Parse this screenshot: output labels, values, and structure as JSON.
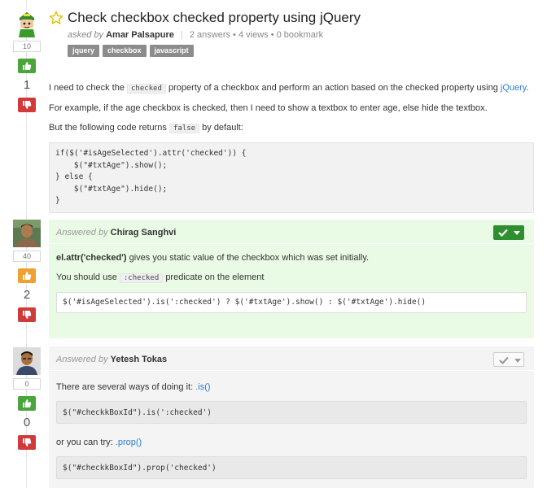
{
  "colors": {
    "accent_link": "#2a7fd4",
    "upvote_green": "#4aa53a",
    "upvote_orange": "#f0a030",
    "downvote_red": "#d03a3a",
    "accepted_bg": "#e9fbe4",
    "accepted_button": "#2f8f2f",
    "answer_bg": "#f4f4f4",
    "tag_bg": "#8c8c8c"
  },
  "question": {
    "title": "Check checkbox checked property using jQuery",
    "asked_by_prefix": "asked by",
    "author": "Amar Palsapure",
    "answers": "2 answers",
    "views": "• 4 views",
    "bookmarks": "• 0 bookmark",
    "reputation": "10",
    "score": "1",
    "tags": [
      "jquery",
      "checkbox",
      "javascript"
    ],
    "p1_before": "I need to check the",
    "p1_code": "checked",
    "p1_after": "property of a checkbox and perform an action based on the checked property using",
    "p1_link": "jQuery",
    "p1_end": ".",
    "p2": "For example, if the age checkbox is checked, then I need to show a textbox to enter age, else hide the textbox.",
    "p3_before": "But the following code returns",
    "p3_code": "false",
    "p3_after": "by default:",
    "code_lines": [
      "if($('#isAgeSelected').attr('checked')) {",
      "    $(\"#txtAge\").show();",
      "} else {",
      "    $(\"#txtAge\").hide();",
      "}"
    ]
  },
  "answers": [
    {
      "answered_by_prefix": "Answered by",
      "author": "Chirag Sanghvi",
      "reputation": "40",
      "score": "2",
      "accepted": true,
      "p1_bold": "el.attr('checked')",
      "p1_rest": "gives you static value of the checkbox which was set initially.",
      "p2_before": "You should use",
      "p2_code": ":checked",
      "p2_after": "predicate on the element",
      "code": "$('#isAgeSelected').is(':checked') ? $('#txtAge').show() : $('#txtAge').hide()"
    },
    {
      "answered_by_prefix": "Answered by",
      "author": "Yetesh Tokas",
      "reputation": "0",
      "score": "0",
      "accepted": false,
      "p1_before": "There are several ways of doing it:",
      "p1_link": ".is()",
      "code1": "$(\"#checkkBoxId\").is(':checked')",
      "p2_before": "or you can try:",
      "p2_link": ".prop()",
      "code2": "$(\"#checkkBoxId\").prop('checked')"
    }
  ]
}
